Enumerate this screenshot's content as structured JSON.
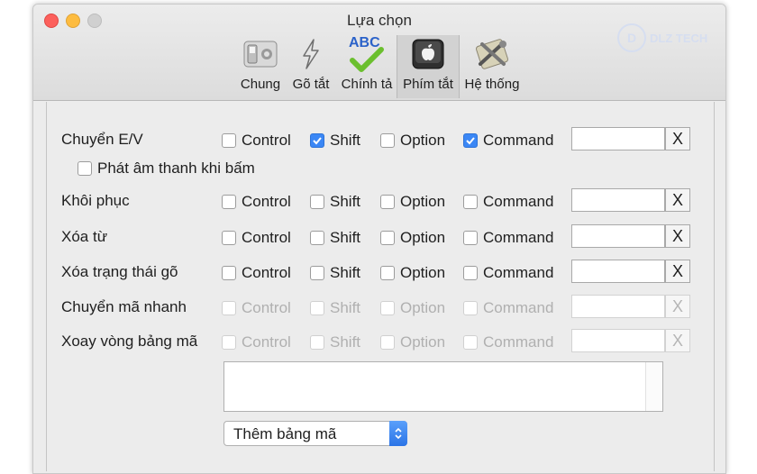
{
  "window": {
    "title": "Lựa chọn"
  },
  "watermark": {
    "logo_text": "D",
    "text": "DLZ TECH"
  },
  "toolbar": {
    "tabs": [
      {
        "label": "Chung",
        "icon": "general-switch-icon",
        "active": false
      },
      {
        "label": "Gõ tắt",
        "icon": "lightning-icon",
        "active": false
      },
      {
        "label": "Chính tả",
        "icon": "abc-check-icon",
        "active": false,
        "icon_text": "ABC"
      },
      {
        "label": "Phím tắt",
        "icon": "apple-key-icon",
        "active": true
      },
      {
        "label": "Hệ thống",
        "icon": "tools-icon",
        "active": false
      }
    ]
  },
  "modifiers": [
    "Control",
    "Shift",
    "Option",
    "Command"
  ],
  "rows": [
    {
      "label": "Chuyển E/V",
      "checked": [
        false,
        true,
        false,
        true
      ],
      "enabled": true,
      "clear": "X"
    },
    {
      "label": "Khôi phục",
      "checked": [
        false,
        false,
        false,
        false
      ],
      "enabled": true,
      "clear": "X"
    },
    {
      "label": "Xóa từ",
      "checked": [
        false,
        false,
        false,
        false
      ],
      "enabled": true,
      "clear": "X"
    },
    {
      "label": "Xóa trạng thái gõ",
      "checked": [
        false,
        false,
        false,
        false
      ],
      "enabled": true,
      "clear": "X"
    },
    {
      "label": "Chuyển mã nhanh",
      "checked": [
        false,
        false,
        false,
        false
      ],
      "enabled": false,
      "clear": "X"
    },
    {
      "label": "Xoay vòng bảng mã",
      "checked": [
        false,
        false,
        false,
        false
      ],
      "enabled": false,
      "clear": "X"
    }
  ],
  "sound_option": {
    "label": "Phát âm thanh khi bấm",
    "checked": false
  },
  "popup": {
    "selected": "Thêm bảng mã"
  },
  "colors": {
    "accent": "#3b87f5",
    "close": "#fc605c",
    "minimize": "#fdbc40"
  }
}
